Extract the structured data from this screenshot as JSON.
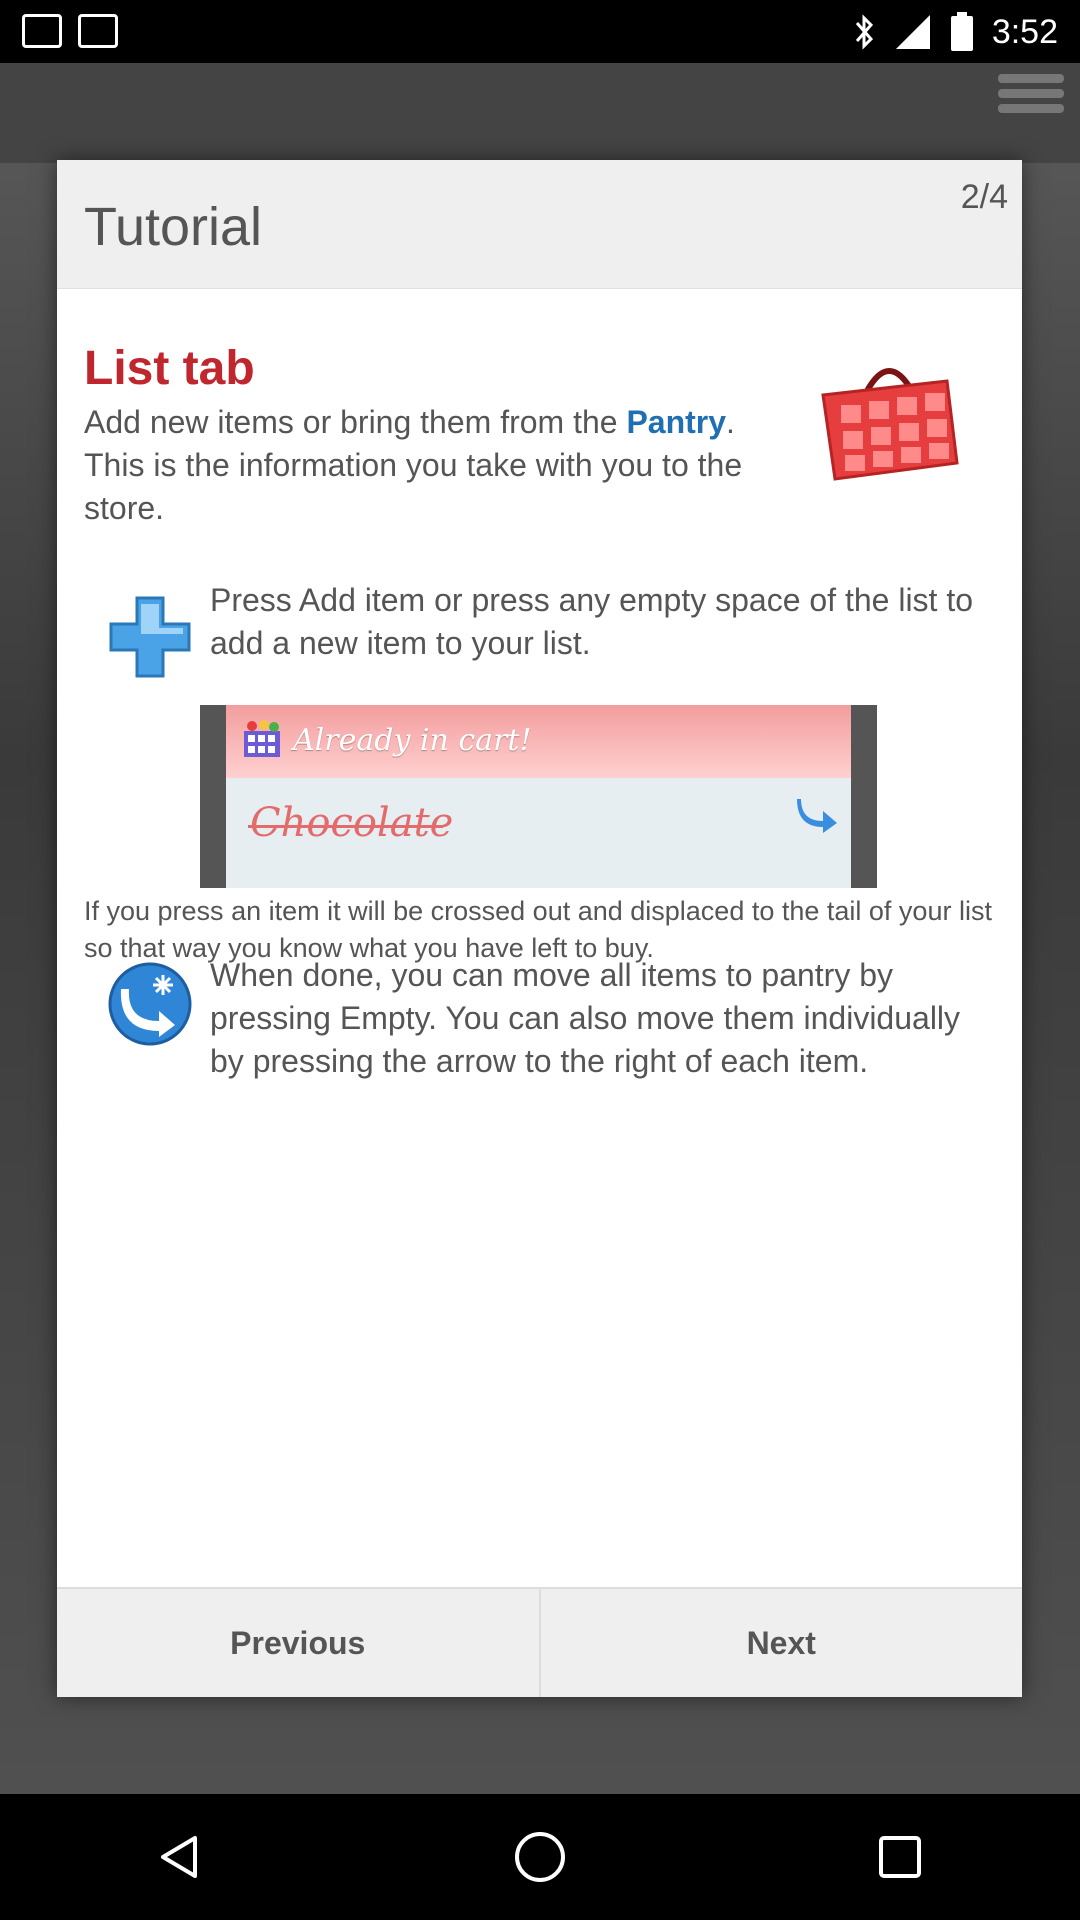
{
  "status_bar": {
    "time": "3:52",
    "icons": [
      "bluetooth-icon",
      "signal-icon",
      "battery-icon"
    ]
  },
  "dialog": {
    "title": "Tutorial",
    "page": "2/4",
    "section_title": "List tab",
    "intro_pre": "Add new items or bring them from the ",
    "intro_link": "Pantry",
    "intro_post": ". This is the information you take with you to the store.",
    "tip_add": "Press Add item or press any empty space of the list to add a new item to your list.",
    "preview": {
      "banner": "Already in cart!",
      "item": "Chocolate"
    },
    "tip_cross": "If you press an item it will be crossed out and displaced to the tail of your list so that way you know what you have left to buy.",
    "tip_move": "When done, you can move all items to pantry by pressing Empty. You can also move them individually by pressing the arrow to the right of each item.",
    "buttons": {
      "previous": "Previous",
      "next": "Next"
    }
  },
  "colors": {
    "accent_red": "#c0262e",
    "link_blue": "#1f6fb2"
  }
}
